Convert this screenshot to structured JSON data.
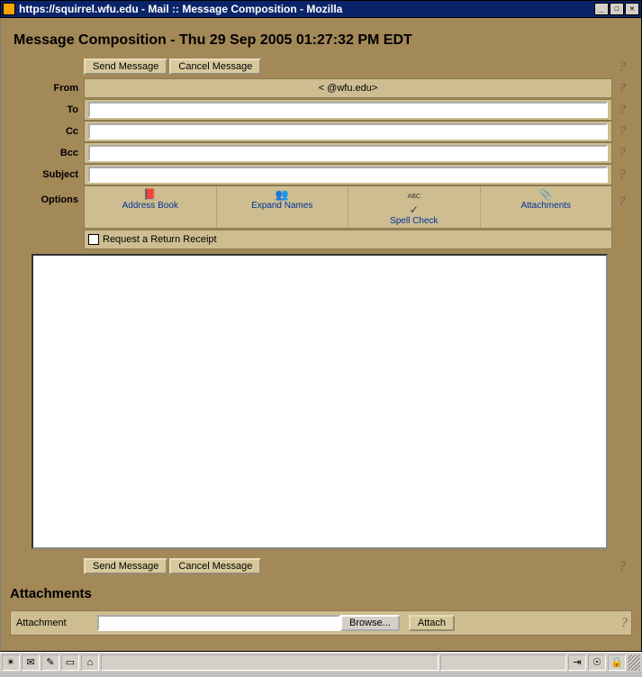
{
  "window": {
    "title": "https://squirrel.wfu.edu - Mail :: Message Composition - Mozilla"
  },
  "page": {
    "heading": "Message Composition - Thu 29 Sep 2005 01:27:32 PM EDT",
    "attachments_heading": "Attachments"
  },
  "buttons": {
    "send": "Send Message",
    "cancel": "Cancel Message",
    "browse": "Browse...",
    "attach": "Attach"
  },
  "labels": {
    "from": "From",
    "to": "To",
    "cc": "Cc",
    "bcc": "Bcc",
    "subject": "Subject",
    "options": "Options",
    "attachment": "Attachment",
    "return_receipt": "Request a Return Receipt"
  },
  "from": {
    "display": "<          @wfu.edu>"
  },
  "fields": {
    "to": "",
    "cc": "",
    "bcc": "",
    "subject": "",
    "body": "",
    "attachment_path": ""
  },
  "options": {
    "address_book": "Address Book",
    "expand_names": "Expand Names",
    "spell_check": "Spell Check",
    "attachments": "Attachments"
  },
  "help": "?"
}
